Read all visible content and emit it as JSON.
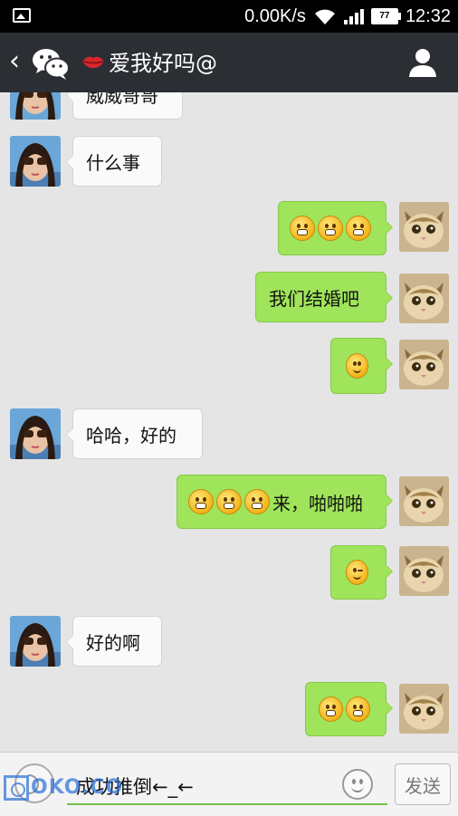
{
  "status_bar": {
    "network_speed": "0.00K/s",
    "battery_level": "77",
    "time": "12:32"
  },
  "header": {
    "back_icon": "back-chevron-icon",
    "app_icon": "wechat-icon",
    "title": "爱我好吗@",
    "profile_icon": "person-icon"
  },
  "messages": [
    {
      "side": "in",
      "text": "威威哥哥"
    },
    {
      "side": "in",
      "text": "什么事"
    },
    {
      "side": "out",
      "text": "",
      "emojis": [
        "grin",
        "grin",
        "grin"
      ]
    },
    {
      "side": "out",
      "text": "我们结婚吧"
    },
    {
      "side": "out",
      "text": "",
      "emojis": [
        "smile"
      ]
    },
    {
      "side": "in",
      "text": "哈哈，好的"
    },
    {
      "side": "out",
      "text": "来，啪啪啪",
      "emojis": [
        "grin",
        "grin",
        "grin"
      ]
    },
    {
      "side": "out",
      "text": "",
      "emojis": [
        "wink"
      ]
    },
    {
      "side": "in",
      "text": "好的啊"
    },
    {
      "side": "out",
      "text": "",
      "emojis": [
        "grin",
        "grin"
      ]
    }
  ],
  "input_bar": {
    "voice_icon": "voice-toggle-icon",
    "input_value": "成功推倒←_←",
    "emoji_icon": "emoji-icon",
    "send_label": "发送"
  },
  "watermark": "OKO.CO",
  "colors": {
    "header_bg": "#2b2e33",
    "chat_bg": "#e5e5e5",
    "outgoing_bubble": "#9fe45a",
    "incoming_bubble": "#fafafa"
  }
}
